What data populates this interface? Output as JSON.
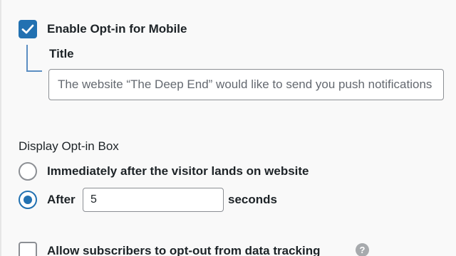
{
  "mobile_optin": {
    "checked": true,
    "label": "Enable Opt-in for Mobile"
  },
  "title_field": {
    "label": "Title",
    "placeholder": "The website “The Deep End” would like to send you push notifications"
  },
  "display_optin": {
    "heading": "Display Opt-in Box",
    "options": [
      {
        "label": "Immediately after the visitor lands on website",
        "selected": false
      },
      {
        "label": "After",
        "selected": true
      }
    ],
    "seconds_value": "5",
    "seconds_suffix": "seconds"
  },
  "data_tracking": {
    "checked": false,
    "label": "Allow subscribers to opt-out from data tracking",
    "help_icon": "question-circle-icon",
    "help_glyph": "?"
  },
  "colors": {
    "accent": "#2271b1",
    "border": "#8c8f94",
    "background": "#f9f9f9"
  }
}
